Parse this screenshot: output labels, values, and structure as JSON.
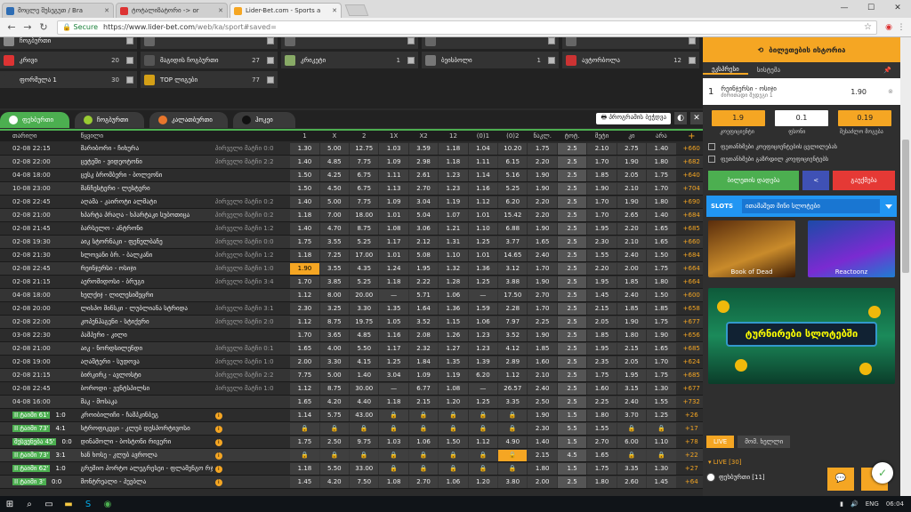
{
  "browser": {
    "tabs": [
      {
        "title": "მოცლე შუსეგუთ / Bra",
        "color": "#2e6db4"
      },
      {
        "title": "ტოტალიზატორი -> or",
        "color": "#d33"
      },
      {
        "title": "Lider-Bet.com - Sports a",
        "color": "#f5a623"
      }
    ],
    "url_secure": "Secure",
    "url_host": "https://www.lider-bet.com",
    "url_path": "/web/ka/sport#saved=",
    "win_min": "—",
    "win_max": "☐",
    "win_close": "✕"
  },
  "sports": [
    {
      "label": "ჩოგბურთი",
      "count": "",
      "color": "#888"
    },
    {
      "label": "",
      "count": "",
      "color": "#666"
    },
    {
      "label": "",
      "count": "",
      "color": "#666"
    },
    {
      "label": "",
      "count": "",
      "color": "#666"
    },
    {
      "label": "",
      "count": "",
      "color": "#666"
    },
    {
      "label": "კრივი",
      "count": "20",
      "color": "#d33"
    },
    {
      "label": "მაგიდის ჩოგბურთი",
      "count": "27",
      "color": "#555"
    },
    {
      "label": "კრიკეტი",
      "count": "1",
      "color": "#8a6"
    },
    {
      "label": "ბეისბოლი",
      "count": "1",
      "color": "#777"
    },
    {
      "label": "ავტორბოლა",
      "count": "12",
      "color": "#c33"
    },
    {
      "label": "ფორმულა 1",
      "count": "30",
      "color": "#333"
    },
    {
      "label": "TOP ლიგები",
      "count": "77",
      "color": "#d4a017"
    }
  ],
  "tabs": [
    {
      "label": "ფეხბურთი",
      "ball": "#fff"
    },
    {
      "label": "ჩოგბურთი",
      "ball": "#9c3"
    },
    {
      "label": "კალათბურთი",
      "ball": "#e8762c"
    },
    {
      "label": "ჰოკეი",
      "ball": "#333"
    }
  ],
  "program_button": "პროგრამის ბეჭდვა",
  "headers": [
    "თარიღი",
    "წყვილი",
    "1",
    "X",
    "2",
    "1X",
    "X2",
    "12",
    "(0)1",
    "(0)2",
    "ნაკლ.",
    "ტოტ.",
    "მეტი",
    "კი",
    "არა",
    "+"
  ],
  "rows": [
    {
      "t": "02-08 22:15",
      "m": "მარიბორი - ჩიხურა",
      "n": "პირველი მატჩი 0:0",
      "o": [
        "1.30",
        "5.00",
        "12.75",
        "1.03",
        "3.59",
        "1.18",
        "1.04",
        "10.20",
        "1.75",
        "2.5",
        "2.10",
        "2.75",
        "1.40"
      ],
      "p": "+660"
    },
    {
      "t": "02-08 22:00",
      "m": "ცეტეში - ვიდეოტონი",
      "n": "პირველი მატჩი 2:2",
      "o": [
        "1.40",
        "4.85",
        "7.75",
        "1.09",
        "2.98",
        "1.18",
        "1.11",
        "6.15",
        "2.20",
        "2.5",
        "1.70",
        "1.90",
        "1.80"
      ],
      "p": "+682"
    },
    {
      "t": "04-08 18:00",
      "m": "ცესკ ბრომბერი - ბოლეონი",
      "n": "",
      "o": [
        "1.50",
        "4.25",
        "6.75",
        "1.11",
        "2.61",
        "1.23",
        "1.14",
        "5.16",
        "1.90",
        "2.5",
        "1.85",
        "2.05",
        "1.75"
      ],
      "p": "+640"
    },
    {
      "t": "10-08 23:00",
      "m": "მანჩესტერი - ლესტერი",
      "n": "",
      "o": [
        "1.50",
        "4.50",
        "6.75",
        "1.13",
        "2.70",
        "1.23",
        "1.16",
        "5.25",
        "1.90",
        "2.5",
        "1.90",
        "2.10",
        "1.70"
      ],
      "p": "+704"
    },
    {
      "t": "02-08 22:45",
      "m": "აღამა - კაიროტი ალმატი",
      "n": "პირველი მატჩი 0:2",
      "o": [
        "1.40",
        "5.00",
        "7.75",
        "1.09",
        "3.04",
        "1.19",
        "1.12",
        "6.20",
        "2.20",
        "2.5",
        "1.70",
        "1.90",
        "1.80"
      ],
      "p": "+690"
    },
    {
      "t": "02-08 21:00",
      "m": "ხპარტა პრაღა - ხპარტაკი სუბოთიცა",
      "n": "პირველი მატჩი 0:2",
      "o": [
        "1.18",
        "7.00",
        "18.00",
        "1.01",
        "5.04",
        "1.07",
        "1.01",
        "15.42",
        "2.20",
        "2.5",
        "1.70",
        "2.65",
        "1.40"
      ],
      "p": "+684"
    },
    {
      "t": "02-08 21:45",
      "m": "ბარსელო - ანტრონი",
      "n": "პირველი მატჩი 1:2",
      "o": [
        "1.40",
        "4.70",
        "8.75",
        "1.08",
        "3.06",
        "1.21",
        "1.10",
        "6.88",
        "1.90",
        "2.5",
        "1.95",
        "2.20",
        "1.65"
      ],
      "p": "+685"
    },
    {
      "t": "02-08 19:30",
      "m": "აიკ სტორნაკი - ფენელბაჩე",
      "n": "პირველი მატჩი 0:0",
      "o": [
        "1.75",
        "3.55",
        "5.25",
        "1.17",
        "2.12",
        "1.31",
        "1.25",
        "3.77",
        "1.65",
        "2.5",
        "2.30",
        "2.10",
        "1.65"
      ],
      "p": "+660"
    },
    {
      "t": "02-08 21:30",
      "m": "სლოვანი ბრ. - ბალკანი",
      "n": "პირველი მატჩი 1:2",
      "o": [
        "1.18",
        "7.25",
        "17.00",
        "1.01",
        "5.08",
        "1.10",
        "1.01",
        "14.65",
        "2.40",
        "2.5",
        "1.55",
        "2.40",
        "1.50"
      ],
      "p": "+684"
    },
    {
      "t": "02-08 22:45",
      "m": "რეინჯერსი - ოსიჯი",
      "n": "პირველი მატჩი 1:0",
      "o": [
        "1.90",
        "3.55",
        "4.35",
        "1.24",
        "1.95",
        "1.32",
        "1.36",
        "3.12",
        "1.70",
        "2.5",
        "2.20",
        "2.00",
        "1.75"
      ],
      "p": "+664",
      "hl": true
    },
    {
      "t": "02-08 21:15",
      "m": "აერომიდოსი - ბრუგი",
      "n": "პირველი მატჩი 3:4",
      "o": [
        "1.70",
        "3.85",
        "5.25",
        "1.18",
        "2.22",
        "1.28",
        "1.25",
        "3.88",
        "1.90",
        "2.5",
        "1.95",
        "1.85",
        "1.80"
      ],
      "p": "+664"
    },
    {
      "t": "04-08 18:00",
      "m": "ხელქიჯ - ლილესიმეცრი",
      "n": "",
      "o": [
        "1.12",
        "8.00",
        "20.00",
        "—",
        "5.71",
        "1.06",
        "—",
        "17.50",
        "2.70",
        "2.5",
        "1.45",
        "2.40",
        "1.50"
      ],
      "p": "+600"
    },
    {
      "t": "02-08 20:00",
      "m": "ლისპო მინსკი - ლუბლიანა სტრიდა",
      "n": "პირველი მატჩი 3:1",
      "o": [
        "2.30",
        "3.25",
        "3.30",
        "1.35",
        "1.64",
        "1.36",
        "1.59",
        "2.28",
        "1.70",
        "2.5",
        "2.15",
        "1.85",
        "1.85"
      ],
      "p": "+658"
    },
    {
      "t": "02-08 22:00",
      "m": "კოპენჰაგენი - სტიქერი",
      "n": "პირველი მატჩი 2:0",
      "o": [
        "1.12",
        "8.75",
        "19.75",
        "1.05",
        "3.52",
        "1.15",
        "1.06",
        "7.97",
        "2.25",
        "2.5",
        "2.05",
        "1.90",
        "1.75"
      ],
      "p": "+677"
    },
    {
      "t": "03-08 22:30",
      "m": "პამპერი - კილი",
      "n": "",
      "o": [
        "1.70",
        "3.65",
        "4.85",
        "1.16",
        "2.08",
        "1.26",
        "1.23",
        "3.52",
        "1.90",
        "2.5",
        "1.85",
        "1.80",
        "1.90"
      ],
      "p": "+656"
    },
    {
      "t": "02-08 21:00",
      "m": "აიკ - ნორდსილენდი",
      "n": "პირველი მატჩი 0:1",
      "o": [
        "1.65",
        "4.00",
        "5.50",
        "1.17",
        "2.32",
        "1.27",
        "1.23",
        "4.12",
        "1.85",
        "2.5",
        "1.95",
        "2.15",
        "1.65"
      ],
      "p": "+685"
    },
    {
      "t": "02-08 19:00",
      "m": "აღაშტერი - სუდოვა",
      "n": "პირველი მატჩი 1:0",
      "o": [
        "2.00",
        "3.30",
        "4.15",
        "1.25",
        "1.84",
        "1.35",
        "1.39",
        "2.89",
        "1.60",
        "2.5",
        "2.35",
        "2.05",
        "1.70"
      ],
      "p": "+624"
    },
    {
      "t": "02-08 21:15",
      "m": "ბირკირკ - ავლოსტი",
      "n": "პირველი მატჩი 2:2",
      "o": [
        "7.75",
        "5.00",
        "1.40",
        "3.04",
        "1.09",
        "1.19",
        "6.20",
        "1.12",
        "2.10",
        "2.5",
        "1.75",
        "1.95",
        "1.75"
      ],
      "p": "+685"
    },
    {
      "t": "02-08 22:45",
      "m": "ბოროდი - ვენტსპილსი",
      "n": "პირველი მატჩი 1:0",
      "o": [
        "1.12",
        "8.75",
        "30.00",
        "—",
        "6.77",
        "1.08",
        "—",
        "26.57",
        "2.40",
        "2.5",
        "1.60",
        "3.15",
        "1.30"
      ],
      "p": "+677"
    },
    {
      "t": "04-08 16:00",
      "m": "მაკ - მოსაკა",
      "n": "",
      "o": [
        "1.65",
        "4.20",
        "4.40",
        "1.18",
        "2.15",
        "1.20",
        "1.25",
        "3.35",
        "2.50",
        "2.5",
        "2.25",
        "2.40",
        "1.55"
      ],
      "p": "+732"
    }
  ],
  "live_rows": [
    {
      "min": "II ტაიმი 61'",
      "sc": "1:0",
      "m": "კროიბილიჩი - ჩამპკინბეგ",
      "o": [
        "1.14",
        "5.75",
        "43.00",
        "🔒",
        "🔒",
        "🔒",
        "🔒",
        "🔒",
        "1.90",
        "1.5",
        "1.80",
        "3.70",
        "1.25"
      ],
      "p": "+26"
    },
    {
      "min": "II ტაიმი 73'",
      "sc": "4:1",
      "m": "სტროფიკეცი - კლუბ დესპორტივოსი",
      "o": [
        "🔒",
        "🔒",
        "🔒",
        "🔒",
        "🔒",
        "🔒",
        "🔒",
        "🔒",
        "2.30",
        "5.5",
        "1.55",
        "🔒",
        "🔒"
      ],
      "p": "+17"
    },
    {
      "min": "შესვენება 45'",
      "sc": "0:0",
      "m": "დინამოლი - ბოსტონი რივერი",
      "o": [
        "1.75",
        "2.50",
        "9.75",
        "1.03",
        "1.06",
        "1.50",
        "1.12",
        "4.90",
        "1.40",
        "1.5",
        "2.70",
        "6.00",
        "1.10"
      ],
      "p": "+78"
    },
    {
      "min": "II ტაიმი 73'",
      "sc": "3:1",
      "m": "ხან ხოსე - კლუბ ავროლა",
      "o": [
        "🔒",
        "🔒",
        "🔒",
        "🔒",
        "🔒",
        "🔒",
        "🔒",
        "🔒",
        "2.15",
        "4.5",
        "1.65",
        "🔒",
        "🔒"
      ],
      "p": "+22",
      "hl": true
    },
    {
      "min": "II ტაიმი 62'",
      "sc": "1:0",
      "m": "გრემიო პორტო ალეგრესეი - ფლამენგო რჯ",
      "o": [
        "1.18",
        "5.50",
        "33.00",
        "🔒",
        "🔒",
        "🔒",
        "🔒",
        "🔒",
        "1.80",
        "1.5",
        "1.75",
        "3.35",
        "1.30"
      ],
      "p": "+27"
    },
    {
      "min": "II ტაიმი 3'",
      "sc": "0:0",
      "m": "მონტრეალი - პუებლა",
      "o": [
        "1.45",
        "4.20",
        "7.50",
        "1.08",
        "2.70",
        "1.06",
        "1.20",
        "3.80",
        "2.00",
        "2.5",
        "1.80",
        "2.60",
        "1.45"
      ],
      "p": "+64"
    }
  ],
  "right": {
    "history": "ბილეთების ისტორია",
    "tab1": "ეკსპრესი",
    "tab2": "სისტემა",
    "slip_num": "1",
    "slip_match": "რეინჯერსი - ოსიჯი",
    "slip_market": "ძირითადი შედეგი  1",
    "slip_odd": "1.90",
    "coef": "1.9",
    "stake": "0.1",
    "win": "0.19",
    "coef_label": "კოეფიციენტი",
    "stake_label": "ფსონი",
    "win_label": "შესაძლო მოგება",
    "cb1": "ფეთანხმები კოეფიციენტების ცვლილებას",
    "cb2": "ფეთანხმები გაზრდილ კოეფიციენტებს",
    "place_bet": "ბილეთის დადება",
    "share": "<",
    "clear": "გაუქმება",
    "slots_label": "SLOTS",
    "slots_select": "ითამაშეთ მინი სლოტები",
    "game1": "Book of Dead",
    "game2": "Reactoonz",
    "promo": "ტურნირები სლოტებში",
    "live_btn": "LIVE",
    "sched_btn": "მომ. ხელლი",
    "live_count": "LIVE [30]",
    "live_fb": "ფეხბურთი [11]"
  },
  "taskbar": {
    "time": "06:04",
    "lang": "ENG"
  },
  "colors": {
    "accent": "#f5a623",
    "green": "#4caf50",
    "red": "#e53935"
  }
}
